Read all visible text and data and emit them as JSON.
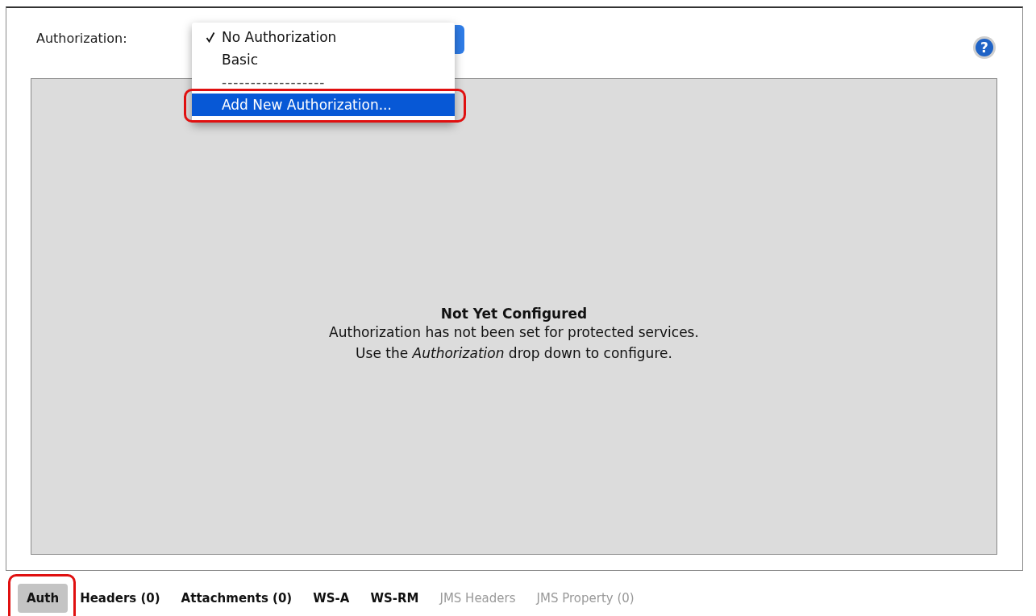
{
  "help": {
    "label": "?"
  },
  "authorization": {
    "label": "Authorization:",
    "menu": [
      {
        "kind": "item",
        "label": "No Authorization",
        "checked": true,
        "selected": false,
        "highlighted": false
      },
      {
        "kind": "item",
        "label": "Basic",
        "checked": false,
        "selected": false,
        "highlighted": false
      },
      {
        "kind": "separator",
        "label": "------------------"
      },
      {
        "kind": "item",
        "label": "Add New Authorization...",
        "checked": false,
        "selected": true,
        "highlighted": true
      }
    ]
  },
  "message": {
    "title": "Not Yet Configured",
    "lines": [
      "Authorization has not been set for protected services.",
      "Use the *Authorization* drop down to configure."
    ]
  },
  "tabs": [
    {
      "label": "Auth",
      "selected": true,
      "disabled": false,
      "highlighted": true
    },
    {
      "label": "Headers (0)",
      "selected": false,
      "disabled": false,
      "highlighted": false
    },
    {
      "label": "Attachments (0)",
      "selected": false,
      "disabled": false,
      "highlighted": false
    },
    {
      "label": "WS-A",
      "selected": false,
      "disabled": false,
      "highlighted": false
    },
    {
      "label": "WS-RM",
      "selected": false,
      "disabled": false,
      "highlighted": false
    },
    {
      "label": "JMS Headers",
      "selected": false,
      "disabled": true,
      "highlighted": false
    },
    {
      "label": "JMS Property (0)",
      "selected": false,
      "disabled": true,
      "highlighted": false
    }
  ]
}
